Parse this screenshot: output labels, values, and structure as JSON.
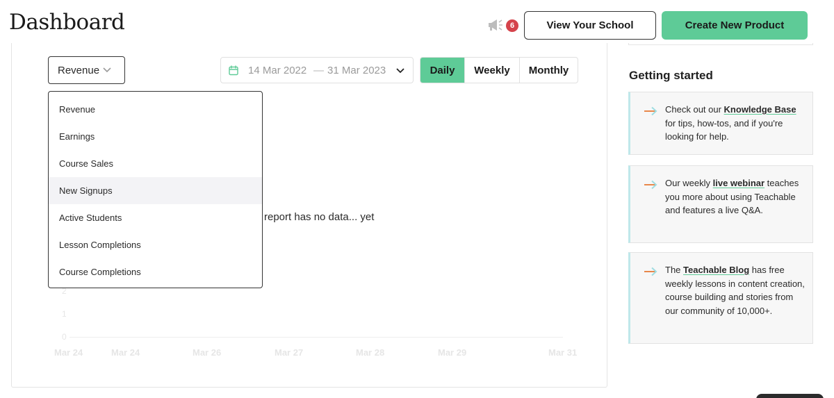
{
  "header": {
    "title": "Dashboard",
    "announcements_icon": "megaphone-icon",
    "notification_count": "6",
    "view_school_label": "View Your School",
    "create_product_label": "Create New Product"
  },
  "colors": {
    "accent": "#5ecb97",
    "badge": "#d5434b",
    "tip_arrow_orange": "#e8874a",
    "tip_arrow_teal": "#9fdce0"
  },
  "report": {
    "metric_selected": "Revenue",
    "metric_options": [
      "Revenue",
      "Earnings",
      "Course Sales",
      "New Signups",
      "Active Students",
      "Lesson Completions",
      "Course Completions"
    ],
    "hovered_option": "New Signups",
    "date_start": "14 Mar 2022",
    "date_separator": "—",
    "date_end": "31 Mar 2023",
    "intervals": [
      "Daily",
      "Weekly",
      "Monthly"
    ],
    "active_interval": "Daily",
    "empty_message": "report has no data... yet",
    "y_ticks": [
      "2",
      "1",
      "0"
    ],
    "x_ticks": [
      "Mar 24",
      "Mar 24",
      "Mar 26",
      "Mar 27",
      "Mar 28",
      "Mar 29",
      "Mar 31"
    ]
  },
  "getting_started": {
    "title": "Getting started",
    "tips": [
      {
        "pre": "Check out our ",
        "link": "Knowledge Base",
        "post": " for tips, how-tos, and if you're looking for help."
      },
      {
        "pre": "Our weekly ",
        "link": "live webinar",
        "post": " teaches you more about using Teachable and features a live Q&A."
      },
      {
        "pre": "The ",
        "link": "Teachable Blog",
        "post": " has free weekly lessons in content creation, course building and stories from our community of 10,000+."
      }
    ]
  }
}
